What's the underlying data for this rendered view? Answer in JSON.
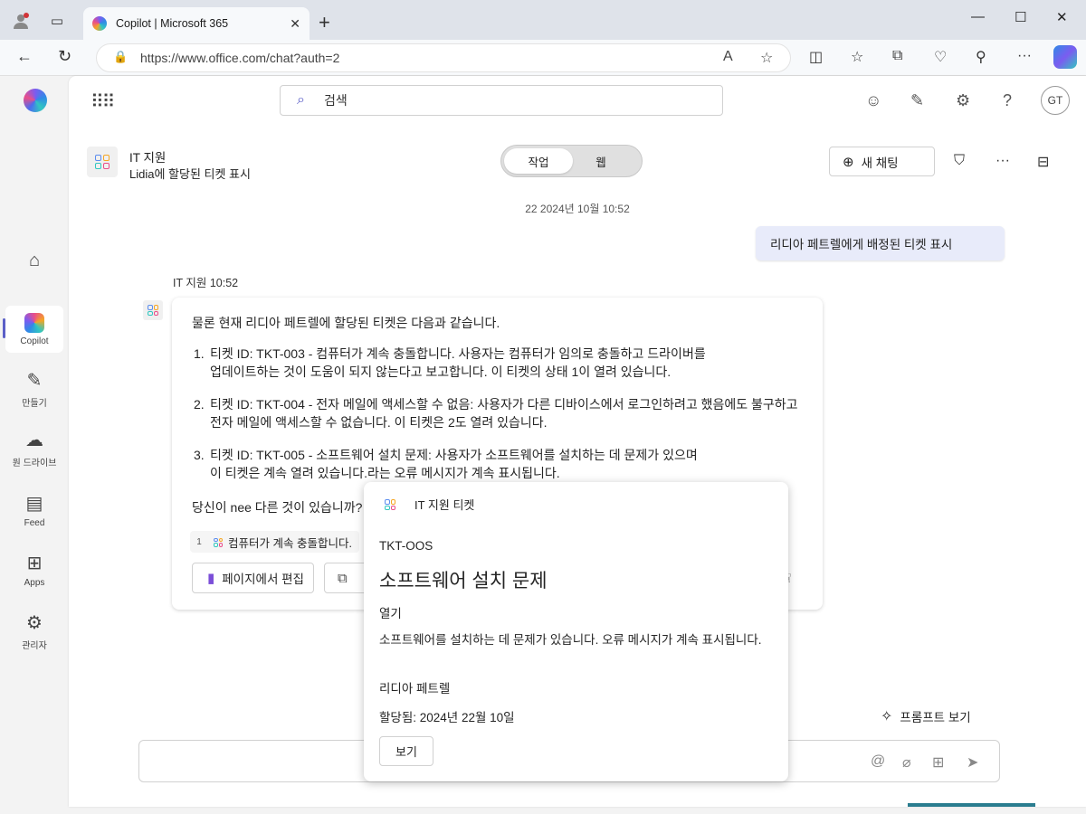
{
  "browser": {
    "tab_title": "Copilot | Microsoft 365",
    "url": "https://www.office.com/chat?auth=2"
  },
  "rail": {
    "items": [
      {
        "label": ""
      },
      {
        "label": "Copilot"
      },
      {
        "label": "만들기"
      },
      {
        "label": "원 드라이브"
      },
      {
        "label": "Feed"
      },
      {
        "label": "Apps"
      },
      {
        "label": "관리자"
      }
    ]
  },
  "header": {
    "search_placeholder": "검색",
    "avatar_initials": "GT"
  },
  "agent": {
    "name": "IT 지원",
    "subtitle": "Lidia에 할당된 티켓 표시"
  },
  "toggle": {
    "work": "작업",
    "web": "웹"
  },
  "new_chat_label": "새 채팅",
  "conversation": {
    "timestamp": "22 2024년 10월 10:52",
    "user_message": "리디아 페트렐에게 배정된 티켓 표시",
    "bot_label": "IT 지원 10:52",
    "intro": "물론 현재 리디아 페트렐에 할당된 티켓은 다음과 같습니다.",
    "tickets": [
      {
        "num": "1.",
        "line1": "티켓 ID: TKT-003 - 컴퓨터가 계속 충돌합니다. 사용자는 컴퓨터가 임의로 충돌하고 드라이버를",
        "line2": "업데이트하는 것이 도움이 되지 않는다고 보고합니다. 이 티켓의 상태 1이 열려 있습니다."
      },
      {
        "num": "2.",
        "line1": "티켓 ID: TKT-004 - 전자 메일에 액세스할 수 없음: 사용자가 다른 디바이스에서 로그인하려고 했음에도 불구하고",
        "line2": "전자 메일에 액세스할 수 없습니다. 이 티켓은 2도 열려 있습니다."
      },
      {
        "num": "3.",
        "line1": "티켓 ID: TKT-005 - 소프트웨어 설치 문제: 사용자가 소프트웨어를 설치하는 데 문제가 있으며",
        "line2": "이 티켓은 계속 열려 있습니다.라는 오류 메시지가 계속 표시됩니다."
      }
    ],
    "question": "당신이 nee 다른 것이 있습니까?",
    "reference_num": "1",
    "reference_text": "컴퓨터가 계속 충돌합니다.",
    "edit_in_pages": "페이지에서 편집"
  },
  "prompt_view": "프롬프트 보기",
  "popup": {
    "header": "IT 지원 티켓",
    "ticket_id": "TKT-OOS",
    "title": "소프트웨어 설치 문제",
    "status": "열기",
    "description": "소프트웨어를 설치하는 데 문제가 있습니다. 오류 메시지가 계속 표시됩니다.",
    "assignee": "리디아 페트렐",
    "assigned_date": "할당됨: 2024년 22월 10일",
    "view_button": "보기"
  }
}
